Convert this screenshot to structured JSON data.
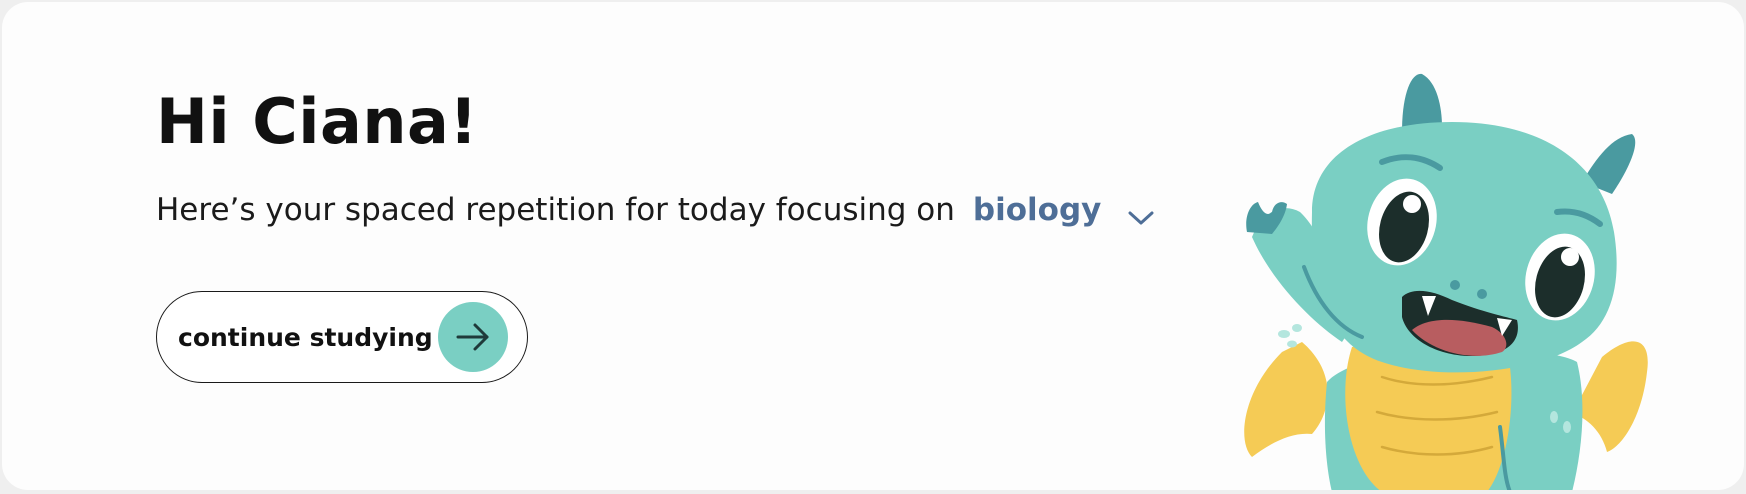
{
  "greeting": "Hi Ciana!",
  "subline": {
    "text": "Here’s your spaced repetition for today focusing on",
    "subject": "biology",
    "dropdown_icon": "chevron-down-icon"
  },
  "cta": {
    "label": "continue studying",
    "icon": "arrow-right-icon"
  },
  "mascot": {
    "icon": "dragon-mascot-illustration"
  },
  "colors": {
    "accent": "#7acfc3",
    "subject": "#4e6e97",
    "dragon_body": "#7acfc3",
    "dragon_dark": "#4a9aa0",
    "dragon_belly": "#f5cb55",
    "dragon_mouth": "#b85d60",
    "text": "#111111"
  }
}
